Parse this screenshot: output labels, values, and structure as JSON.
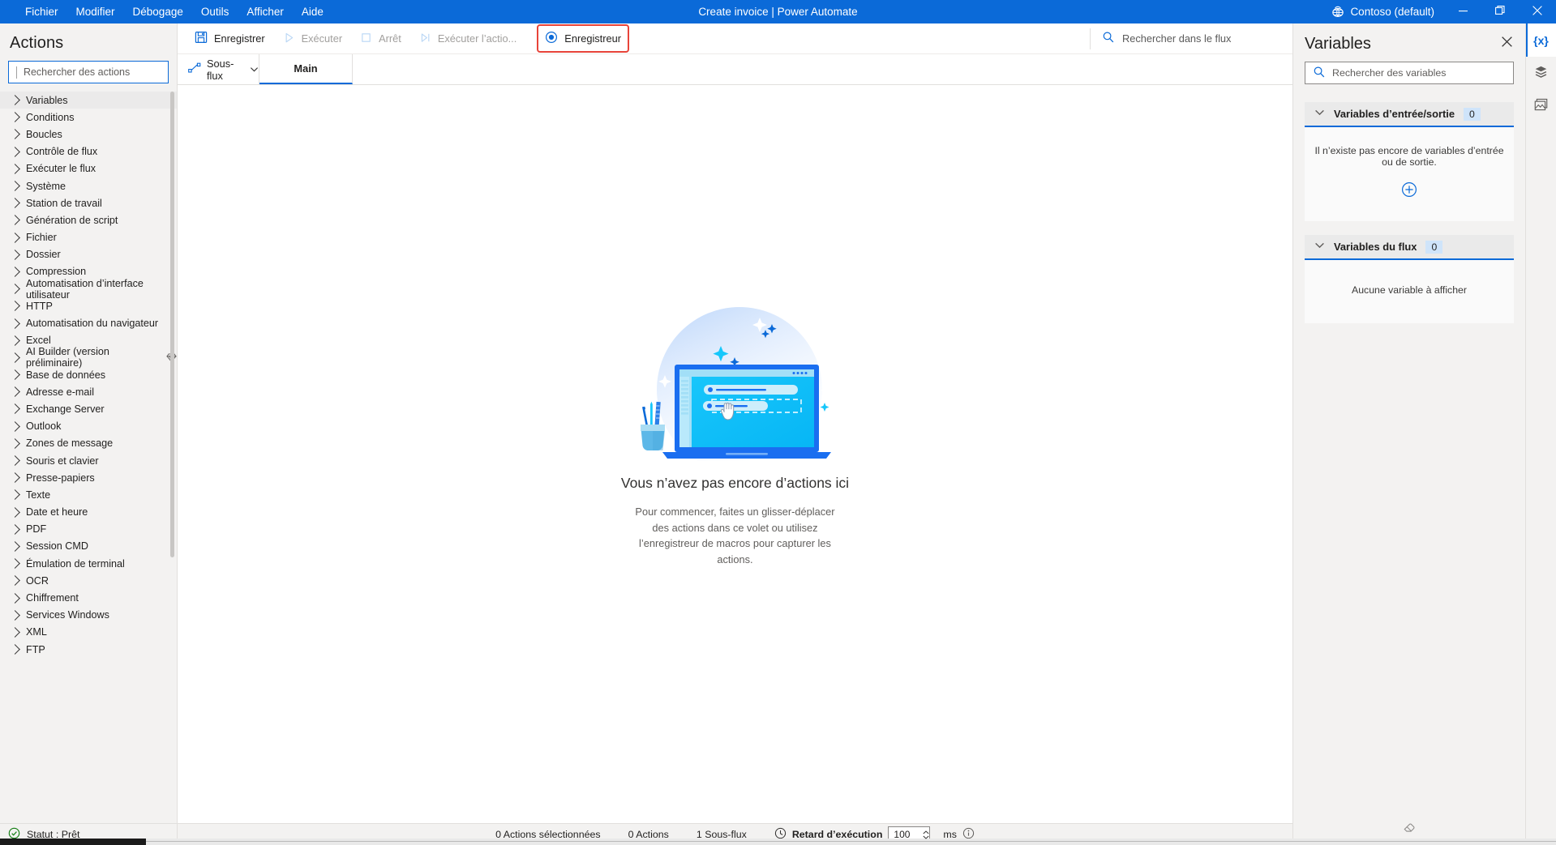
{
  "titlebar": {
    "menus": [
      "Fichier",
      "Modifier",
      "Débogage",
      "Outils",
      "Afficher",
      "Aide"
    ],
    "document_title": "Create invoice | Power Automate",
    "tenant": "Contoso (default)",
    "tenant_icon": "globe-tenant-icon",
    "minimize_icon": "minimize-icon",
    "maximize_icon": "maximize-icon",
    "close_icon": "close-icon",
    "accent_color": "#0b6ad8"
  },
  "sidebar": {
    "title": "Actions",
    "search_placeholder": "Rechercher des actions",
    "search_value": "",
    "items": [
      {
        "label": "Variables",
        "selected": true
      },
      {
        "label": "Conditions",
        "selected": false
      },
      {
        "label": "Boucles",
        "selected": false
      },
      {
        "label": "Contrôle de flux",
        "selected": false
      },
      {
        "label": "Exécuter le flux",
        "selected": false
      },
      {
        "label": "Système",
        "selected": false
      },
      {
        "label": "Station de travail",
        "selected": false
      },
      {
        "label": "Génération de script",
        "selected": false
      },
      {
        "label": "Fichier",
        "selected": false
      },
      {
        "label": "Dossier",
        "selected": false
      },
      {
        "label": "Compression",
        "selected": false
      },
      {
        "label": "Automatisation d’interface utilisateur",
        "selected": false
      },
      {
        "label": "HTTP",
        "selected": false
      },
      {
        "label": "Automatisation du navigateur",
        "selected": false
      },
      {
        "label": "Excel",
        "selected": false
      },
      {
        "label": "AI Builder (version préliminaire)",
        "selected": false,
        "badge": "preview-diamond-icon"
      },
      {
        "label": "Base de données",
        "selected": false
      },
      {
        "label": "Adresse e-mail",
        "selected": false
      },
      {
        "label": "Exchange Server",
        "selected": false
      },
      {
        "label": "Outlook",
        "selected": false
      },
      {
        "label": "Zones de message",
        "selected": false
      },
      {
        "label": "Souris et clavier",
        "selected": false
      },
      {
        "label": "Presse-papiers",
        "selected": false
      },
      {
        "label": "Texte",
        "selected": false
      },
      {
        "label": "Date et heure",
        "selected": false
      },
      {
        "label": "PDF",
        "selected": false
      },
      {
        "label": "Session CMD",
        "selected": false
      },
      {
        "label": "Émulation de terminal",
        "selected": false
      },
      {
        "label": "OCR",
        "selected": false
      },
      {
        "label": "Chiffrement",
        "selected": false
      },
      {
        "label": "Services Windows",
        "selected": false
      },
      {
        "label": "XML",
        "selected": false
      },
      {
        "label": "FTP",
        "selected": false
      }
    ],
    "status": "Statut : Prêt",
    "status_icon": "check-circle-icon",
    "status_color": "#107c10"
  },
  "toolbar": {
    "save_label": "Enregistrer",
    "run_label": "Exécuter",
    "stop_label": "Arrêt",
    "run_action_label": "Exécuter l’actio...",
    "recorder_label": "Enregistreur",
    "recorder_highlighted": true,
    "highlight_color": "#e8443a",
    "search_placeholder": "Rechercher dans le flux",
    "search_value": "",
    "icons": {
      "save": "save-disk-icon",
      "run": "play-icon",
      "stop": "stop-square-icon",
      "run_action": "step-over-icon",
      "recorder": "record-radio-icon",
      "search": "search-icon"
    }
  },
  "tabs": {
    "subflow_label": "Sous-flux",
    "subflow_icon": "subflow-nodes-icon",
    "subflow_chevron": "chevron-down-icon",
    "main_label": "Main",
    "main_active": true
  },
  "canvas": {
    "empty_title": "Vous n’avez pas encore d’actions ici",
    "empty_subtitle": "Pour commencer, faites un glisser-déplacer des actions dans ce volet ou utilisez l’enregistreur de macros pour capturer les actions.",
    "illustration": "laptop-drag-drop-illustration"
  },
  "statusbar": {
    "selected_actions": "0 Actions sélectionnées",
    "actions_count": "0 Actions",
    "subflows_count": "1 Sous-flux",
    "delay_label": "Retard d’exécution",
    "delay_icon": "clock-icon",
    "delay_value": "100",
    "delay_unit": "ms",
    "info_icon": "info-circle-icon"
  },
  "variables_panel": {
    "title": "Variables",
    "close_icon": "close-icon",
    "search_placeholder": "Rechercher des variables",
    "search_value": "",
    "search_icon": "search-icon",
    "sections": [
      {
        "title": "Variables d’entrée/sortie",
        "count": "0",
        "chevron": "chevron-down-icon",
        "empty_text": "Il n’existe pas encore de variables d’entrée ou de sortie.",
        "add_icon": "plus-circle-icon",
        "has_add": true
      },
      {
        "title": "Variables du flux",
        "count": "0",
        "chevron": "chevron-down-icon",
        "empty_text": "Aucune variable à afficher",
        "has_add": false
      }
    ],
    "footer_icon": "eraser-icon",
    "accent_color": "#0b6ad8",
    "count_badge_color": "#cfe4fa"
  },
  "rail": {
    "items": [
      {
        "name": "variables-rail-icon",
        "glyph": "{x}",
        "active": true
      },
      {
        "name": "ui-elements-rail-icon",
        "glyph": "layers",
        "active": false
      },
      {
        "name": "images-rail-icon",
        "glyph": "images",
        "active": false
      }
    ]
  }
}
